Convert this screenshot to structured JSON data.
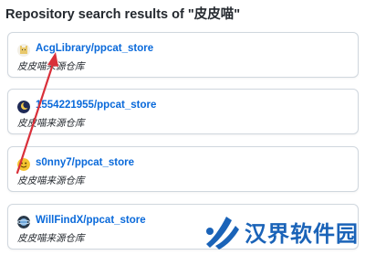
{
  "page": {
    "heading": "Repository search results of \"皮皮喵\""
  },
  "results": [
    {
      "repo": "AcgLibrary/ppcat_store",
      "description": "皮皮喵来源仓库",
      "avatar": "pixel-cat-avatar"
    },
    {
      "repo": "1554221955/ppcat_store",
      "description": "皮皮喵来源仓库",
      "avatar": "moon-avatar"
    },
    {
      "repo": "s0nny7/ppcat_store",
      "description": "皮皮喵来源仓库",
      "avatar": "emoji-face-avatar"
    },
    {
      "repo": "WillFindX/ppcat_store",
      "description": "皮皮喵来源仓库",
      "avatar": "planet-avatar"
    }
  ],
  "annotation": {
    "color": "#d9303a"
  },
  "watermark": {
    "text": "汉界软件园",
    "color": "#1a63b8"
  }
}
